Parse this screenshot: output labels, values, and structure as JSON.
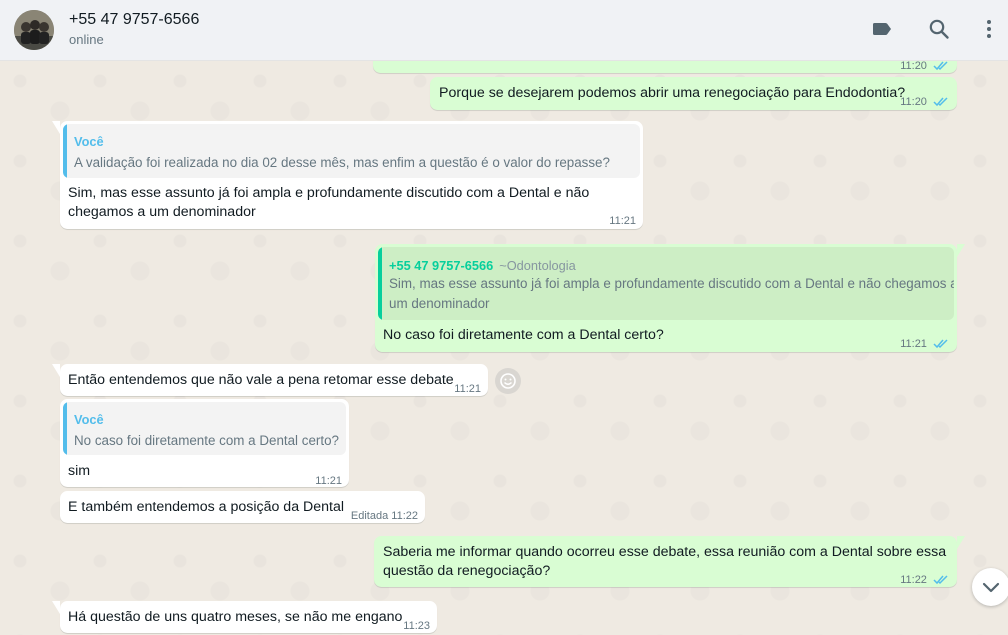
{
  "header": {
    "contact_name": "+55 47 9757-6566",
    "status": "online",
    "icons": [
      "label-icon",
      "search-icon",
      "menu-icon"
    ]
  },
  "colors": {
    "accent_blue": "#53bdeb",
    "quote_you": "#53bdeb",
    "quote_contact": "#06cf9c",
    "incoming_bg": "#ffffff",
    "outgoing_bg": "#d9fdd3"
  },
  "messages": [
    {
      "id": "m0",
      "dir": "out",
      "text": "",
      "time": "11:20"
    },
    {
      "id": "m1",
      "dir": "out",
      "text": "Porque se desejarem podemos abrir uma renegociação para Endodontia?",
      "time": "11:20"
    },
    {
      "id": "m2",
      "dir": "in",
      "quote": {
        "author": "Você",
        "text": "A validação foi realizada no dia 02 desse mês, mas enfim a questão é o valor do repasse?"
      },
      "lines": [
        "Sim, mas esse assunto já foi ampla e profundamente discutido com a Dental e não",
        "chegamos a um denominador"
      ],
      "time": "11:21"
    },
    {
      "id": "m3",
      "dir": "out",
      "quote": {
        "author": "+55 47 9757-6566",
        "sub": "~Odontologia",
        "lines": [
          "Sim, mas esse assunto já foi ampla e profundamente discutido com a Dental e não chegamos a",
          "um denominador"
        ]
      },
      "text": "No caso foi diretamente com a Dental certo?",
      "time": "11:21"
    },
    {
      "id": "m4",
      "dir": "in",
      "text": "Então entendemos que não vale a pena retomar esse debate",
      "time": "11:21"
    },
    {
      "id": "m5",
      "dir": "in",
      "quote": {
        "author": "Você",
        "text": "No caso foi diretamente com a Dental certo?"
      },
      "text": "sim",
      "time": "11:21"
    },
    {
      "id": "m6",
      "dir": "in",
      "text": "E também entendemos a posição da Dental",
      "edited": "Editada",
      "time": "11:22"
    },
    {
      "id": "m7",
      "dir": "out",
      "lines": [
        "Saberia me informar quando ocorreu esse debate, essa reunião com a Dental sobre essa",
        "questão da renegociação?"
      ],
      "time": "11:22"
    },
    {
      "id": "m8",
      "dir": "in",
      "text": "Há questão de uns quatro meses, se não me engano",
      "time": "11:23"
    }
  ]
}
